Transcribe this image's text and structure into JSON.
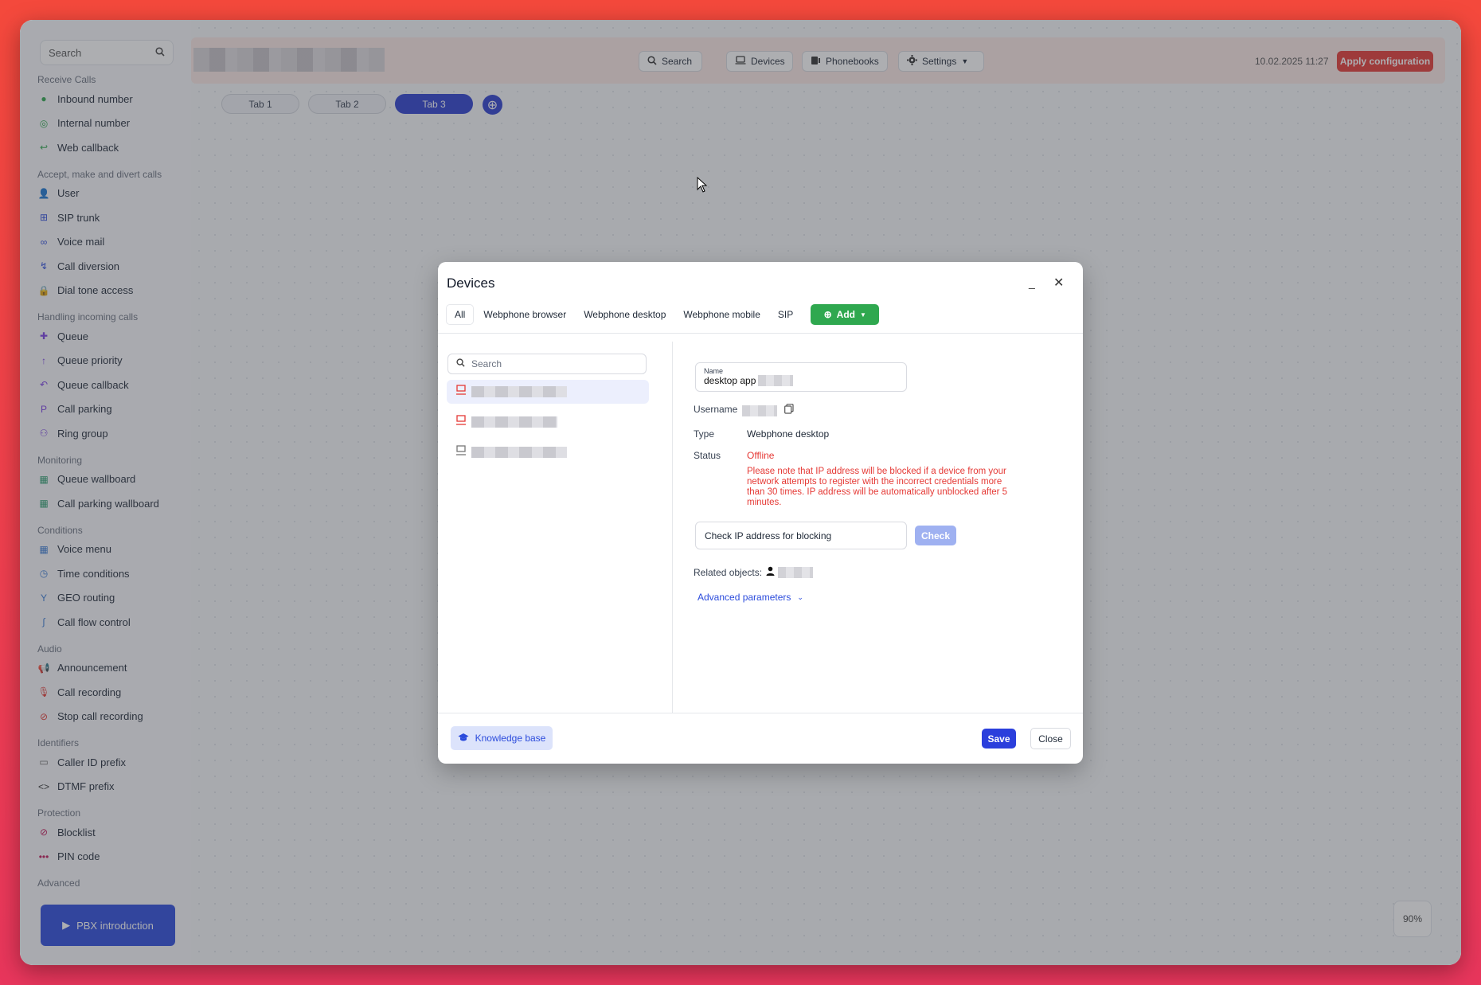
{
  "sidebar": {
    "search_placeholder": "Search",
    "sections": [
      {
        "title": "Receive Calls",
        "items": [
          {
            "label": "Inbound number",
            "icon": "inbound-number-icon"
          },
          {
            "label": "Internal number",
            "icon": "internal-number-icon"
          },
          {
            "label": "Web callback",
            "icon": "web-callback-icon"
          }
        ]
      },
      {
        "title": "Accept, make and divert calls",
        "items": [
          {
            "label": "User",
            "icon": "user-icon"
          },
          {
            "label": "SIP trunk",
            "icon": "sip-trunk-icon"
          },
          {
            "label": "Voice mail",
            "icon": "voicemail-icon"
          },
          {
            "label": "Call diversion",
            "icon": "call-diversion-icon"
          },
          {
            "label": "Dial tone access",
            "icon": "lock-icon"
          }
        ]
      },
      {
        "title": "Handling incoming calls",
        "items": [
          {
            "label": "Queue",
            "icon": "queue-icon"
          },
          {
            "label": "Queue priority",
            "icon": "arrow-up-icon"
          },
          {
            "label": "Queue callback",
            "icon": "queue-callback-icon"
          },
          {
            "label": "Call parking",
            "icon": "parking-icon"
          },
          {
            "label": "Ring group",
            "icon": "ring-group-icon"
          }
        ]
      },
      {
        "title": "Monitoring",
        "items": [
          {
            "label": "Queue wallboard",
            "icon": "wallboard-icon"
          },
          {
            "label": "Call parking wallboard",
            "icon": "wallboard-icon"
          }
        ]
      },
      {
        "title": "Conditions",
        "items": [
          {
            "label": "Voice menu",
            "icon": "voice-menu-icon"
          },
          {
            "label": "Time conditions",
            "icon": "clock-icon"
          },
          {
            "label": "GEO routing",
            "icon": "geo-routing-icon"
          },
          {
            "label": "Call flow control",
            "icon": "call-flow-icon"
          }
        ]
      },
      {
        "title": "Audio",
        "items": [
          {
            "label": "Announcement",
            "icon": "megaphone-icon"
          },
          {
            "label": "Call recording",
            "icon": "microphone-icon"
          },
          {
            "label": "Stop call recording",
            "icon": "microphone-off-icon"
          }
        ]
      },
      {
        "title": "Identifiers",
        "items": [
          {
            "label": "Caller ID prefix",
            "icon": "caller-id-icon"
          },
          {
            "label": "DTMF prefix",
            "icon": "code-icon"
          }
        ]
      },
      {
        "title": "Protection",
        "items": [
          {
            "label": "Blocklist",
            "icon": "block-icon"
          },
          {
            "label": "PIN code",
            "icon": "pin-icon"
          }
        ]
      },
      {
        "title": "Advanced",
        "items": []
      }
    ],
    "pbx_intro_label": "PBX introduction"
  },
  "topbar": {
    "search_label": "Search",
    "devices_label": "Devices",
    "phonebooks_label": "Phonebooks",
    "settings_label": "Settings",
    "datetime": "10.02.2025 11:27",
    "apply_label": "Apply configuration"
  },
  "tabs": [
    {
      "label": "Tab 1",
      "active": false
    },
    {
      "label": "Tab 2",
      "active": false
    },
    {
      "label": "Tab 3",
      "active": true
    }
  ],
  "zoom": "90%",
  "dialog": {
    "title": "Devices",
    "tabs": [
      "All",
      "Webphone browser",
      "Webphone desktop",
      "Webphone mobile",
      "SIP"
    ],
    "add_label": "Add",
    "list_search_placeholder": "Search",
    "device_count": 3,
    "name_label": "Name",
    "name_value": "desktop app",
    "username_label": "Username",
    "type_label": "Type",
    "type_value": "Webphone desktop",
    "status_label": "Status",
    "status_value": "Offline",
    "warning_text": "Please note that IP address will be blocked if a device from your network attempts to register with the incorrect credentials more than 30 times. IP address will be automatically unblocked after 5 minutes.",
    "ip_check_placeholder": "Check IP address for blocking",
    "check_label": "Check",
    "related_label": "Related objects:",
    "advanced_label": "Advanced parameters",
    "knowledge_label": "Knowledge base",
    "save_label": "Save",
    "close_label": "Close"
  },
  "colors": {
    "accent": "#2b3fcf",
    "apply": "#e53935",
    "add": "#2fa84f",
    "offline": "#e53935"
  }
}
